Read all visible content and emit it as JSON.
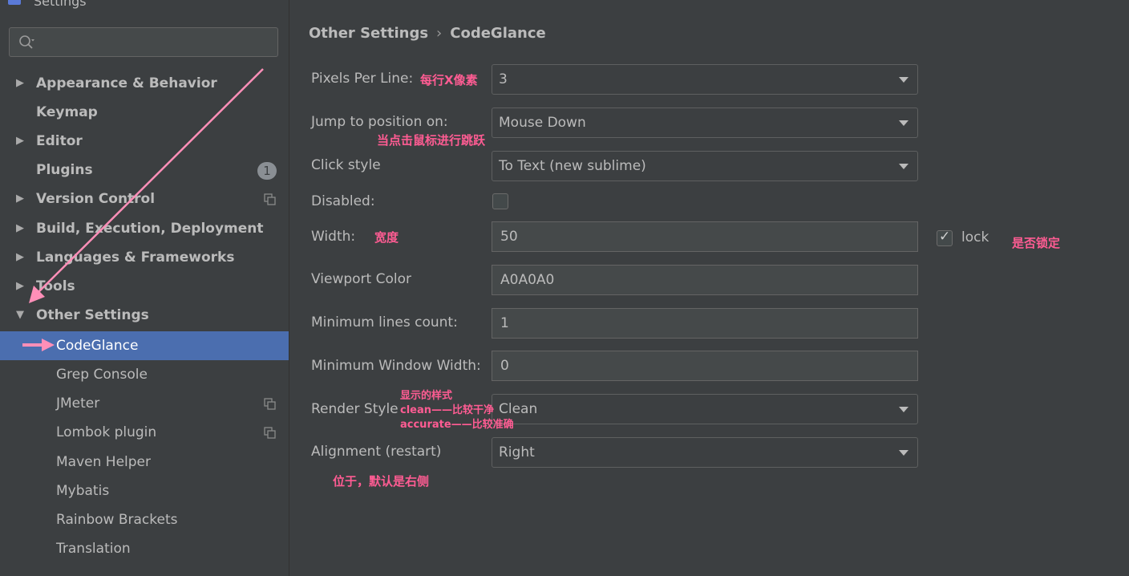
{
  "window": {
    "title": "Settings"
  },
  "search": {
    "placeholder": ""
  },
  "sidebar": {
    "items": [
      {
        "label": "Appearance & Behavior"
      },
      {
        "label": "Keymap"
      },
      {
        "label": "Editor"
      },
      {
        "label": "Plugins",
        "badge": "1"
      },
      {
        "label": "Version Control"
      },
      {
        "label": "Build, Execution, Deployment"
      },
      {
        "label": "Languages & Frameworks"
      },
      {
        "label": "Tools"
      },
      {
        "label": "Other Settings"
      }
    ],
    "children": [
      {
        "label": "CodeGlance"
      },
      {
        "label": "Grep Console"
      },
      {
        "label": "JMeter"
      },
      {
        "label": "Lombok plugin"
      },
      {
        "label": "Maven Helper"
      },
      {
        "label": "Mybatis"
      },
      {
        "label": "Rainbow Brackets"
      },
      {
        "label": "Translation"
      }
    ]
  },
  "breadcrumb": {
    "parent": "Other Settings",
    "separator": "›",
    "current": "CodeGlance"
  },
  "form": {
    "pixels_per_line": {
      "label": "Pixels Per Line:",
      "value": "3"
    },
    "jump_to_position": {
      "label": "Jump to position on:",
      "value": "Mouse Down"
    },
    "click_style": {
      "label": "Click style",
      "value": "To Text (new sublime)"
    },
    "disabled": {
      "label": "Disabled:",
      "checked": false
    },
    "width": {
      "label": "Width:",
      "value": "50",
      "lock_label": "lock",
      "lock_checked": true
    },
    "viewport_color": {
      "label": "Viewport Color",
      "value": "A0A0A0"
    },
    "min_lines": {
      "label": "Minimum lines count:",
      "value": "1"
    },
    "min_window_width": {
      "label": "Minimum Window Width:",
      "value": "0"
    },
    "render_style": {
      "label": "Render Style",
      "value": "Clean"
    },
    "alignment": {
      "label": "Alignment (restart)",
      "value": "Right"
    }
  },
  "annotations": {
    "pixels_per_line": "每行X像素",
    "jump": "当点击鼠标进行跳跃",
    "width": "宽度",
    "lock": "是否锁定",
    "render_1": "显示的样式",
    "render_2": "clean——比较干净",
    "render_3": "accurate——比较准确",
    "alignment": "位于，默认是右侧"
  },
  "colors": {
    "accent": "#ff5c93",
    "selection": "#4b6eaf",
    "background": "#3c3f41"
  }
}
